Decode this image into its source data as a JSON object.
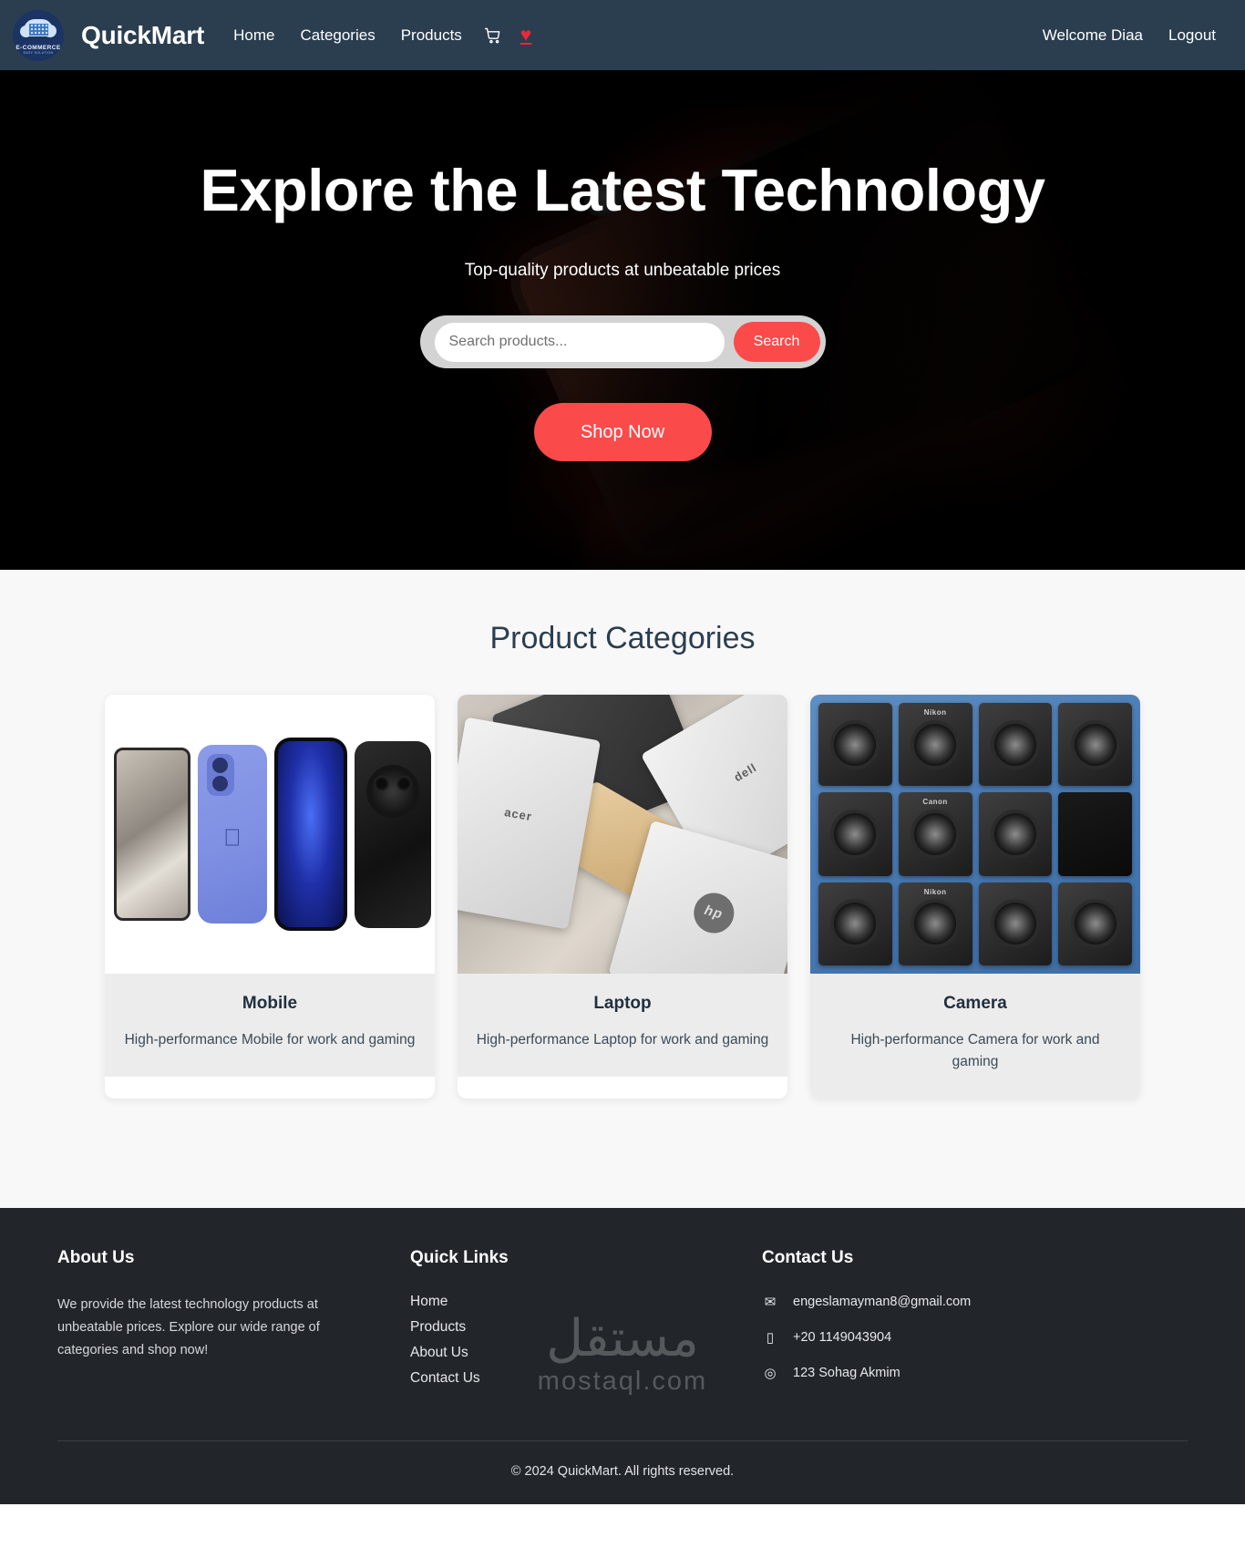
{
  "navbar": {
    "brand": "QuickMart",
    "logo_line1": "E-COMMERCE",
    "logo_line2": "EASY SOLUTION",
    "links": [
      {
        "label": "Home"
      },
      {
        "label": "Categories"
      },
      {
        "label": "Products"
      }
    ],
    "cart_icon": "shopping-cart-icon",
    "wishlist_icon": "heart-icon",
    "wishlist_glyph": "♥",
    "welcome": "Welcome Diaa",
    "logout": "Logout",
    "background_color": "#2b3e50"
  },
  "hero": {
    "title": "Explore the Latest Technology",
    "subtitle": "Top-quality products at unbeatable prices",
    "search_placeholder": "Search products...",
    "search_value": "",
    "search_button": "Search",
    "cta_button": "Shop Now",
    "accent_color": "#fb4a4a",
    "background_color": "#000000"
  },
  "categories": {
    "section_title": "Product Categories",
    "items": [
      {
        "name": "Mobile",
        "description": "High-performance Mobile for work and gaming",
        "image_alt": "four-smartphones-lineup"
      },
      {
        "name": "Laptop",
        "description": "High-performance Laptop for work and gaming",
        "image_alt": "pile-of-laptops-dell-apple-acer-hp"
      },
      {
        "name": "Camera",
        "description": "High-performance Camera for work and gaming",
        "image_alt": "grid-of-dslr-cameras-on-blue-background"
      }
    ]
  },
  "footer": {
    "about": {
      "heading": "About Us",
      "text": "We provide the latest technology products at unbeatable prices. Explore our wide range of categories and shop now!"
    },
    "quick_links": {
      "heading": "Quick Links",
      "items": [
        {
          "label": "Home"
        },
        {
          "label": "Products"
        },
        {
          "label": "About Us"
        },
        {
          "label": "Contact Us"
        }
      ]
    },
    "contact": {
      "heading": "Contact Us",
      "items": [
        {
          "icon": "envelope-icon",
          "glyph": "✉",
          "value": "engeslamayman8@gmail.com"
        },
        {
          "icon": "mobile-phone-icon",
          "glyph": "▯",
          "value": "+20 1149043904"
        },
        {
          "icon": "map-pin-icon",
          "glyph": "◎",
          "value": "123 Sohag Akmim"
        }
      ]
    },
    "copyright": "© 2024 QuickMart. All rights reserved.",
    "background_color": "#22262b"
  },
  "watermark": {
    "arabic": "مستقل",
    "latin": "mostaql.com"
  }
}
